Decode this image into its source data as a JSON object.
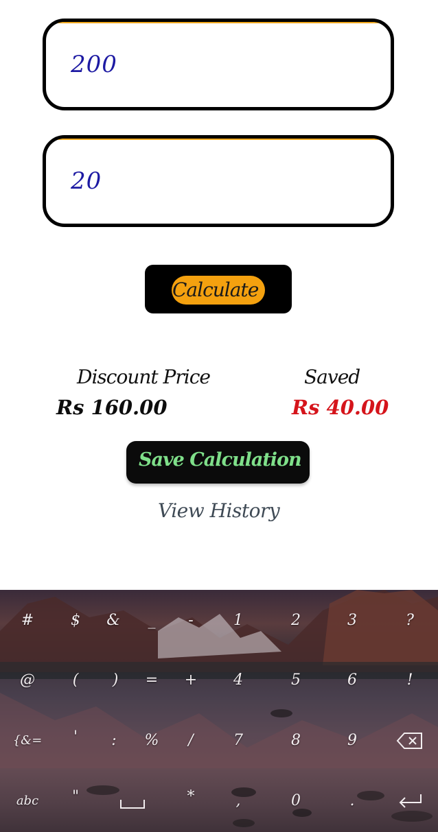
{
  "inputs": {
    "price": {
      "value": "200"
    },
    "discount": {
      "value": "20"
    }
  },
  "calculate_label": "Calculate",
  "results": {
    "discount_price_label": "Discount Price",
    "discount_price_value": "Rs 160.00",
    "saved_label": "Saved",
    "saved_value": "Rs 40.00"
  },
  "save_calculation_label": "Save Calculation",
  "view_history_label": "View History",
  "keyboard": {
    "rows": [
      [
        "#",
        "$",
        "&",
        "_",
        "-",
        "1",
        "2",
        "3",
        "?"
      ],
      [
        "@",
        "(",
        ")",
        "=",
        "+",
        "4",
        "5",
        "6",
        "!"
      ],
      [
        "{&=",
        "'",
        ":",
        "%",
        "/",
        "7",
        "8",
        "9"
      ],
      [
        "abc",
        "\"",
        "*",
        ",",
        "0",
        "."
      ]
    ]
  },
  "colors": {
    "field_border": "#000000",
    "field_accent": "#f2a91d",
    "input_text": "#1d1aa3",
    "calculate_pill": "#f4a10f",
    "save_text": "#7fe08a",
    "saved_value": "#d5141b"
  }
}
